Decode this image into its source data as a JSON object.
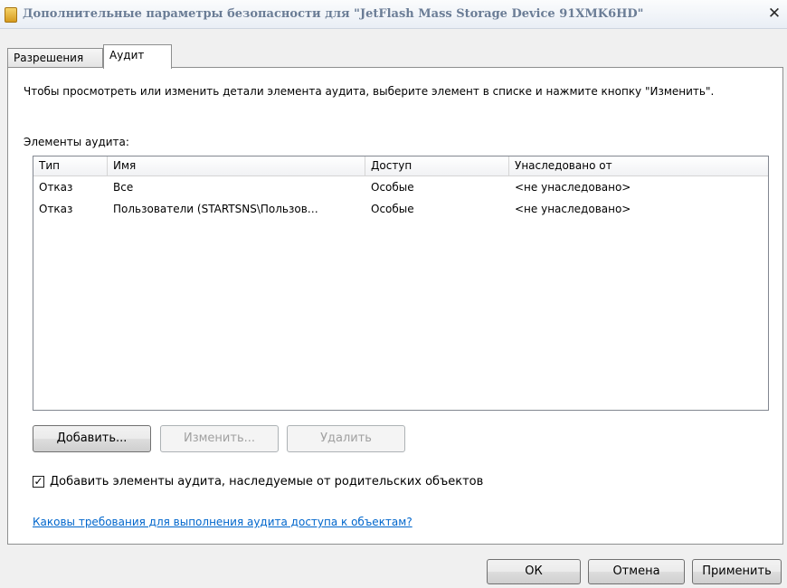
{
  "window": {
    "title": "Дополнительные параметры безопасности для \"JetFlash Mass Storage Device 91XMK6HD\"",
    "close_symbol": "✕",
    "icon": "folder-icon"
  },
  "tabs": [
    {
      "label": "Разрешения",
      "active": false
    },
    {
      "label": "Аудит",
      "active": true
    }
  ],
  "audit": {
    "instruction": "Чтобы просмотреть или изменить детали элемента аудита, выберите элемент в списке и нажмите кнопку \"Изменить\".",
    "list_label": "Элементы аудита:",
    "columns": [
      "Тип",
      "Имя",
      "Доступ",
      "Унаследовано от"
    ],
    "rows": [
      [
        "Отказ",
        "Все",
        "Особые",
        "<не унаследовано>"
      ],
      [
        "Отказ",
        "Пользователи (STARTSNS\\Пользов…",
        "Особые",
        "<не унаследовано>"
      ]
    ],
    "buttons": {
      "add": "Добавить...",
      "change": "Изменить...",
      "delete": "Удалить"
    },
    "inherit_checkbox": {
      "label": "Добавить элементы аудита, наследуемые от родительских объектов",
      "checked": true,
      "mark": "✓"
    },
    "help_link": "Каковы требования для выполнения аудита доступа к объектам?"
  },
  "footer": {
    "ok": "ОК",
    "cancel": "Отмена",
    "apply": "Применить"
  },
  "colors": {
    "title_text": "#6b7d96",
    "link": "#0066cc",
    "disabled_text": "#a0a0a0"
  }
}
